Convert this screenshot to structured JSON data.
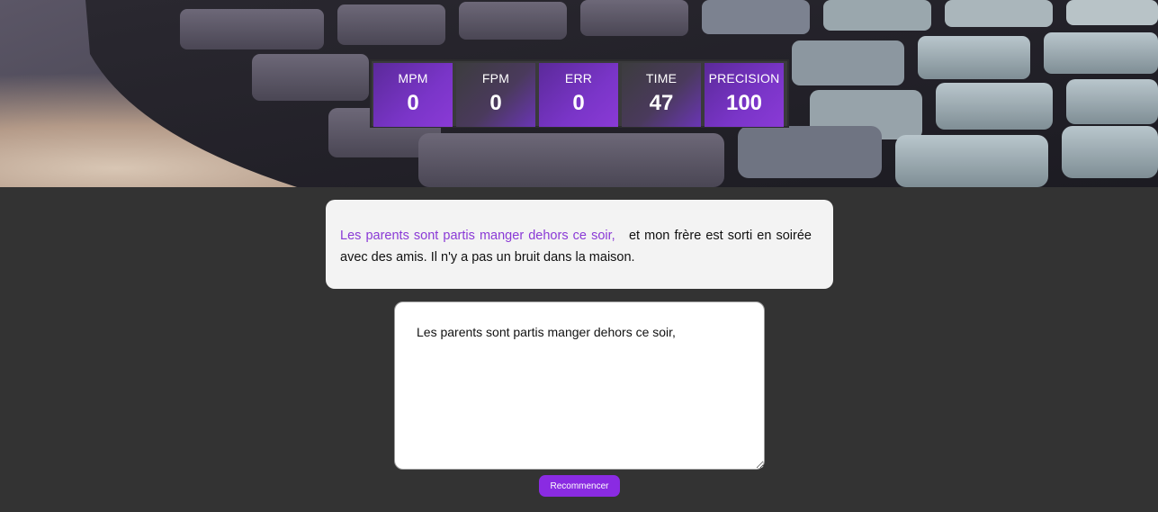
{
  "stats": [
    {
      "label": "MPM",
      "value": "0"
    },
    {
      "label": "FPM",
      "value": "0"
    },
    {
      "label": "ERR",
      "value": "0"
    },
    {
      "label": "TIME",
      "value": "47"
    },
    {
      "label": "PRECISION",
      "value": "100"
    }
  ],
  "quote": {
    "typed": "Les parents sont partis manger dehors ce soir,",
    "remaining": "et mon frère est sorti en soirée avec des amis. Il n'y a pas un bruit dans la maison."
  },
  "input": {
    "value": "Les parents sont partis manger dehors ce soir,"
  },
  "restart_label": "Recommencer",
  "colors": {
    "accent": "#8a2be2",
    "page_background": "#333333",
    "card_background": "#f3f3f3"
  }
}
